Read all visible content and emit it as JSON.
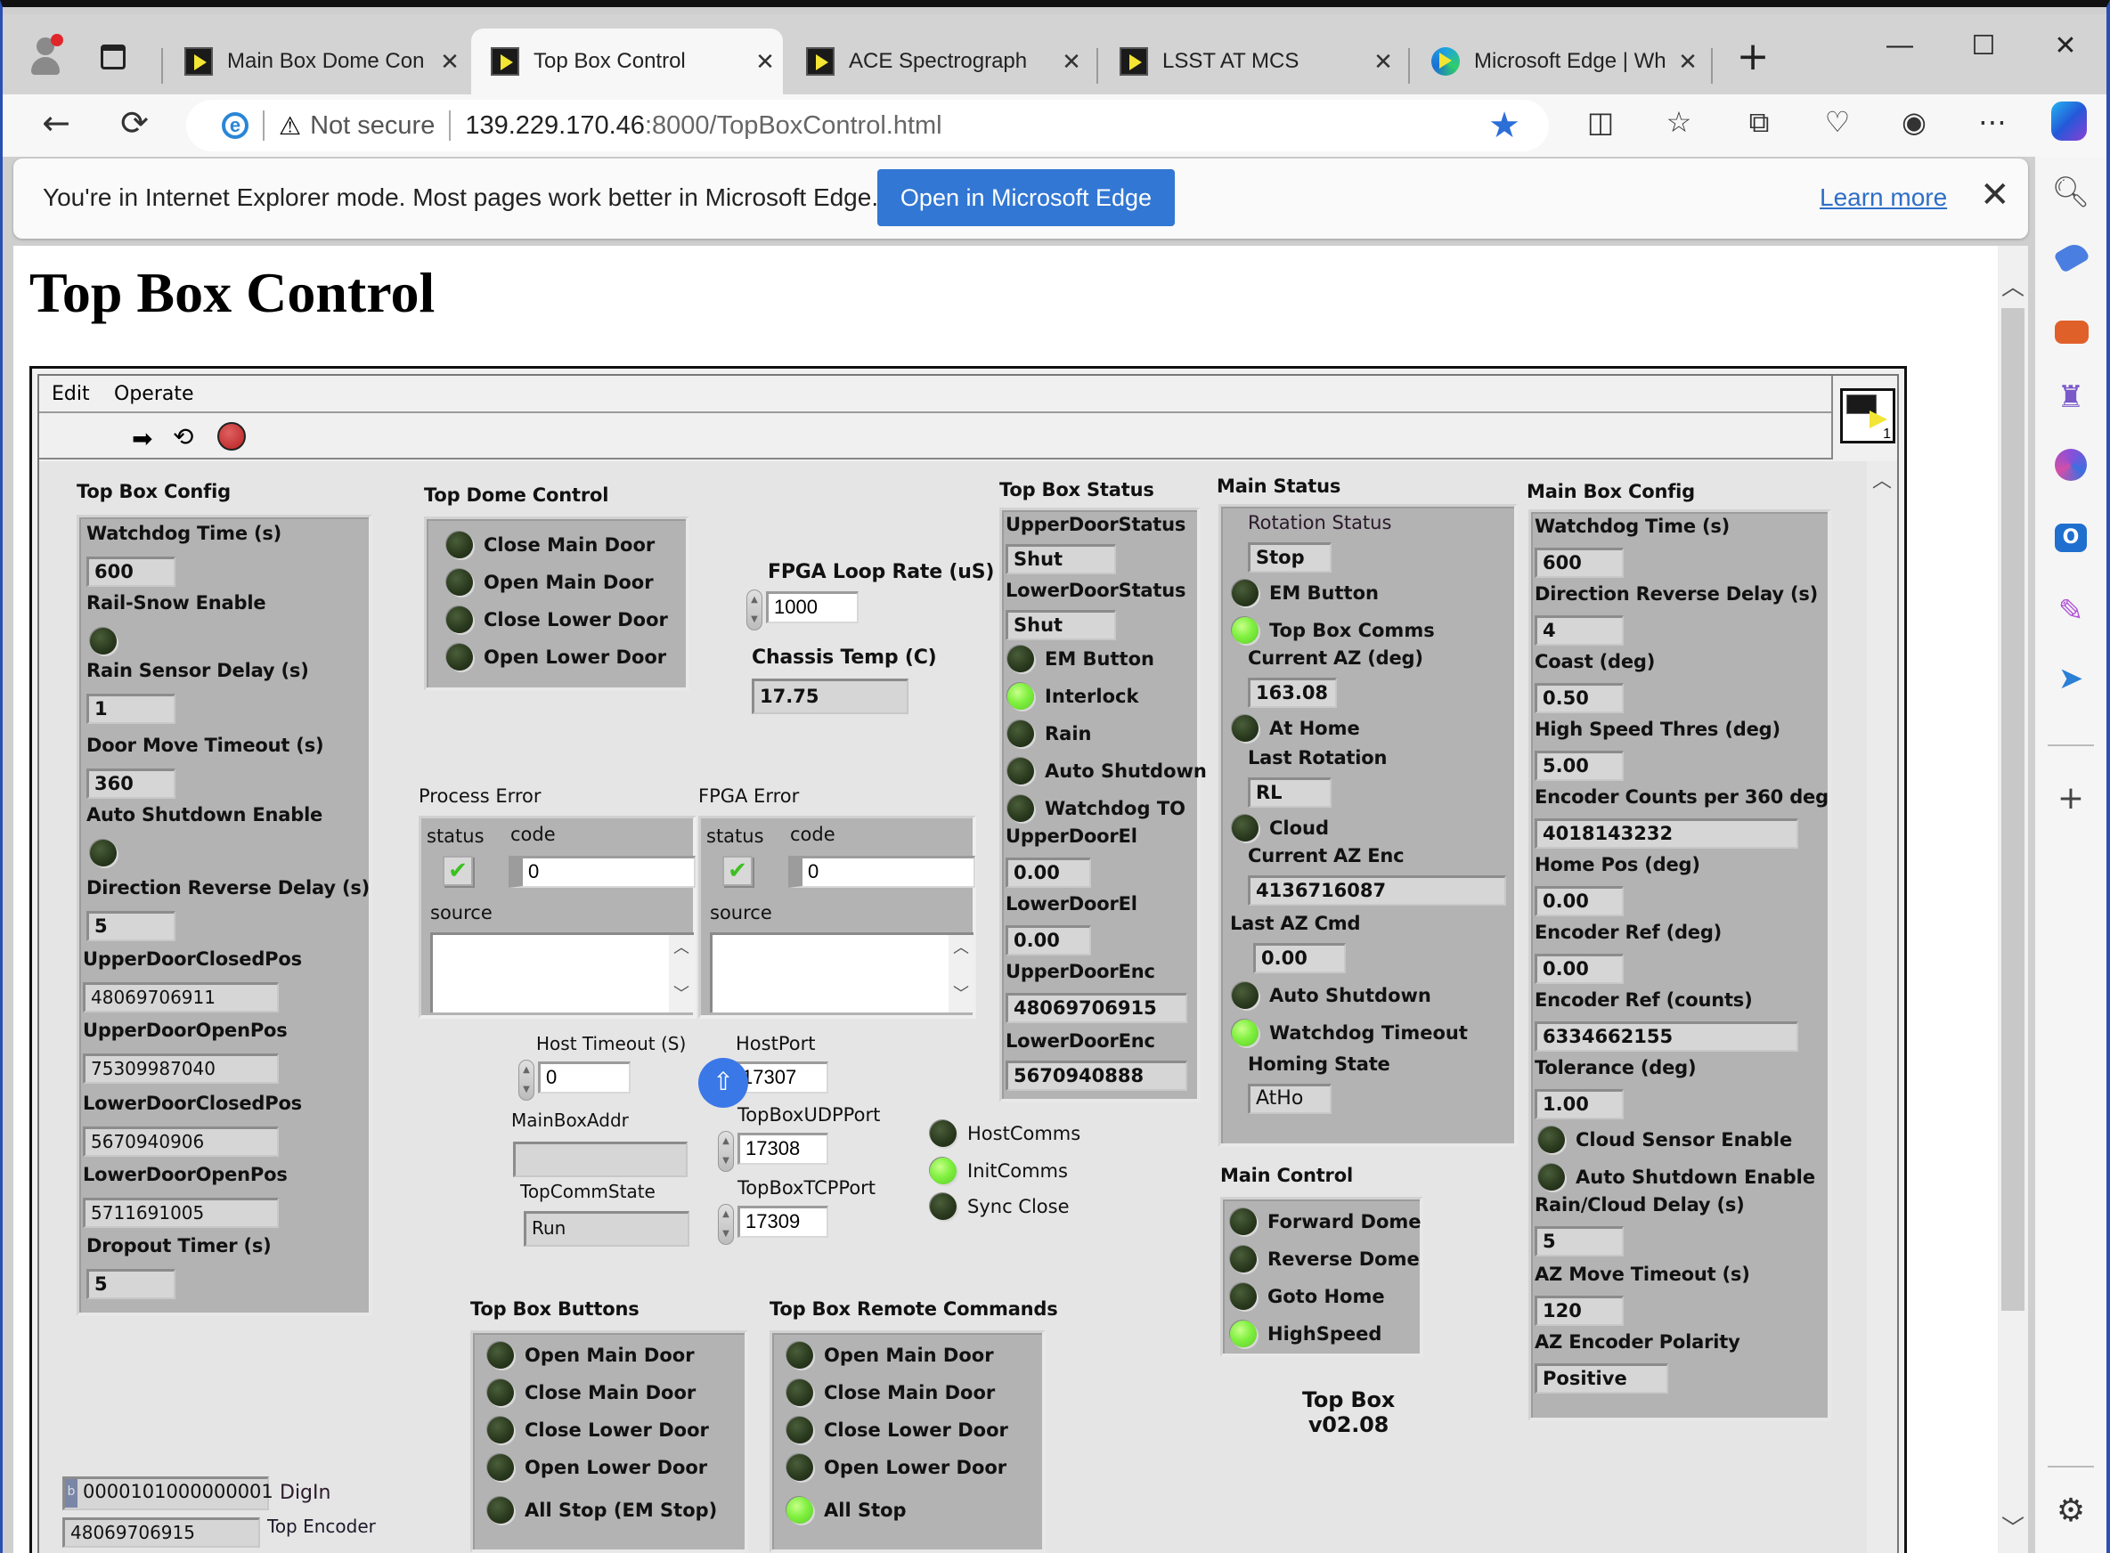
{
  "browser": {
    "tabs": [
      {
        "title": "Main Box Dome Con",
        "active": false
      },
      {
        "title": "Top Box Control",
        "active": true
      },
      {
        "title": "ACE Spectrograph",
        "active": false
      },
      {
        "title": "LSST AT MCS",
        "active": false
      },
      {
        "title": "Microsoft Edge | Wh",
        "active": false
      }
    ],
    "tab_close_glyph": "✕",
    "new_tab_glyph": "+",
    "window_controls": {
      "minimize": "—",
      "maximize": "☐",
      "close": "✕"
    },
    "address": {
      "security_label": "Not secure",
      "host": "139.229.170.46",
      "path": ":8000/TopBoxControl.html"
    },
    "ie_banner": {
      "message": "You're in Internet Explorer mode. Most pages work better in Microsoft Edge.",
      "open_button": "Open in Microsoft Edge",
      "learn_more": "Learn more"
    }
  },
  "page": {
    "title": "Top Box Control"
  },
  "labview": {
    "menu": [
      "Edit",
      "Operate"
    ],
    "vi_icon_number": "1",
    "top_box_config": {
      "title": "Top Box Config",
      "watchdog_time_label": "Watchdog Time (s)",
      "watchdog_time": "600",
      "rail_snow_label": "Rail-Snow Enable",
      "rail_snow_on": false,
      "rain_delay_label": "Rain Sensor Delay (s)",
      "rain_delay": "1",
      "door_timeout_label": "Door Move Timeout (s)",
      "door_timeout": "360",
      "auto_shutdown_label": "Auto Shutdown Enable",
      "auto_shutdown_on": false,
      "dir_rev_label": "Direction Reverse Delay (s)",
      "dir_rev": "5",
      "upper_closed_label": "UpperDoorClosedPos",
      "upper_closed": "48069706911",
      "upper_open_label": "UpperDoorOpenPos",
      "upper_open": "75309987040",
      "lower_closed_label": "LowerDoorClosedPos",
      "lower_closed": "5670940906",
      "lower_open_label": "LowerDoorOpenPos",
      "lower_open": "5711691005",
      "dropout_label": "Dropout Timer (s)",
      "dropout": "5"
    },
    "top_dome_control": {
      "title": "Top Dome Control",
      "items": [
        {
          "label": "Close Main Door",
          "on": false
        },
        {
          "label": "Open Main Door",
          "on": false
        },
        {
          "label": "Close Lower Door",
          "on": false
        },
        {
          "label": "Open Lower Door",
          "on": false
        }
      ]
    },
    "fpga": {
      "loop_rate_label": "FPGA Loop Rate (uS)",
      "loop_rate": "1000",
      "chassis_temp_label": "Chassis Temp (C)",
      "chassis_temp": "17.75"
    },
    "process_error": {
      "title": "Process Error",
      "status_label": "status",
      "code_label": "code",
      "code_radix": "d",
      "code": "0",
      "source_label": "source",
      "source": ""
    },
    "fpga_error": {
      "title": "FPGA Error",
      "status_label": "status",
      "code_label": "code",
      "code_radix": "d",
      "code": "0",
      "source_label": "source",
      "source": ""
    },
    "comms": {
      "host_timeout_label": "Host Timeout (S)",
      "host_timeout": "0",
      "host_port_label": "HostPort",
      "host_port": "17307",
      "mainbox_addr_label": "MainBoxAddr",
      "mainbox_addr": "",
      "udp_port_label": "TopBoxUDPPort",
      "udp_port": "17308",
      "topcomm_state_label": "TopCommState",
      "topcomm_state": "Run",
      "tcp_port_label": "TopBoxTCPPort",
      "tcp_port": "17309",
      "leds": [
        {
          "label": "HostComms",
          "on": false
        },
        {
          "label": "InitComms",
          "on": true
        },
        {
          "label": "Sync Close",
          "on": false
        }
      ]
    },
    "top_box_status": {
      "title": "Top Box Status",
      "upper_status_label": "UpperDoorStatus",
      "upper_status": "Shut",
      "lower_status_label": "LowerDoorStatus",
      "lower_status": "Shut",
      "leds": [
        {
          "label": "EM Button",
          "on": false
        },
        {
          "label": "Interlock",
          "on": true
        },
        {
          "label": "Rain",
          "on": false
        },
        {
          "label": "Auto Shutdown",
          "on": false
        },
        {
          "label": "Watchdog TO",
          "on": false
        }
      ],
      "upper_el_label": "UpperDoorEl",
      "upper_el": "0.00",
      "lower_el_label": "LowerDoorEl",
      "lower_el": "0.00",
      "upper_enc_label": "UpperDoorEnc",
      "upper_enc": "48069706915",
      "lower_enc_label": "LowerDoorEnc",
      "lower_enc": "5670940888"
    },
    "main_status": {
      "title": "Main Status",
      "rotation_label": "Rotation Status",
      "rotation": "Stop",
      "em_button_label": "EM Button",
      "em_button_on": false,
      "top_comms_label": "Top Box Comms",
      "top_comms_on": true,
      "current_az_label": "Current AZ (deg)",
      "current_az": "163.08",
      "at_home_label": "At Home",
      "at_home_on": false,
      "last_rotation_label": "Last Rotation",
      "last_rotation": "RL",
      "cloud_label": "Cloud",
      "cloud_on": false,
      "az_enc_label": "Current AZ Enc",
      "az_enc": "4136716087",
      "last_az_cmd_label": "Last AZ Cmd",
      "last_az_cmd": "0.00",
      "auto_shutdown_label": "Auto Shutdown",
      "auto_shutdown_on": false,
      "watchdog_label": "Watchdog Timeout",
      "watchdog_on": true,
      "homing_label": "Homing State",
      "homing": "AtHo"
    },
    "main_control": {
      "title": "Main Control",
      "items": [
        {
          "label": "Forward Dome",
          "on": false
        },
        {
          "label": "Reverse Dome",
          "on": false
        },
        {
          "label": "Goto Home",
          "on": false
        },
        {
          "label": "HighSpeed",
          "on": true
        }
      ]
    },
    "version": {
      "line1": "Top Box",
      "line2": "v02.08"
    },
    "main_box_config": {
      "title": "Main Box Config",
      "watchdog_label": "Watchdog Time (s)",
      "watchdog": "600",
      "dir_rev_label": "Direction Reverse Delay (s)",
      "dir_rev": "4",
      "coast_label": "Coast (deg)",
      "coast": "0.50",
      "hs_thres_label": "High Speed Thres (deg)",
      "hs_thres": "5.00",
      "enc_counts_label": "Encoder Counts per 360 deg",
      "enc_counts": "4018143232",
      "home_pos_label": "Home Pos (deg)",
      "home_pos": "0.00",
      "enc_ref_deg_label": "Encoder Ref (deg)",
      "enc_ref_deg": "0.00",
      "enc_ref_counts_label": "Encoder Ref (counts)",
      "enc_ref_counts": "6334662155",
      "tolerance_label": "Tolerance (deg)",
      "tolerance": "1.00",
      "cloud_enable_label": "Cloud Sensor Enable",
      "cloud_enable_on": false,
      "auto_shutdown_label": "Auto Shutdown Enable",
      "auto_shutdown_on": false,
      "rain_cloud_label": "Rain/Cloud Delay (s)",
      "rain_cloud": "5",
      "az_timeout_label": "AZ Move Timeout (s)",
      "az_timeout": "120",
      "polarity_label": "AZ Encoder Polarity",
      "polarity": "Positive"
    },
    "top_box_buttons": {
      "title": "Top Box Buttons",
      "items": [
        {
          "label": "Open Main Door",
          "on": false
        },
        {
          "label": "Close Main Door",
          "on": false
        },
        {
          "label": "Close Lower Door",
          "on": false
        },
        {
          "label": "Open Lower Door",
          "on": false
        },
        {
          "label": "All Stop (EM Stop)",
          "on": false
        }
      ]
    },
    "remote_commands": {
      "title": "Top Box Remote Commands",
      "items": [
        {
          "label": "Open Main Door",
          "on": false
        },
        {
          "label": "Close Main Door",
          "on": false
        },
        {
          "label": "Close Lower Door",
          "on": false
        },
        {
          "label": "Open Lower Door",
          "on": false
        },
        {
          "label": "All Stop",
          "on": true
        }
      ]
    },
    "digin": {
      "radix": "b",
      "value": "0000101000000001",
      "label": "DigIn"
    },
    "top_encoder": {
      "value": "48069706915",
      "label": "Top Encoder"
    }
  }
}
